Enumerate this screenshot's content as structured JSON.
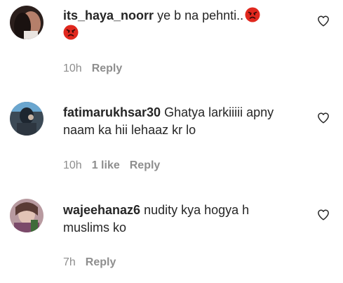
{
  "comments": [
    {
      "username": "its_haya_noorr",
      "text": "ye b na pehnti..",
      "emoji_icons": [
        "angry-face-icon",
        "angry-face-icon"
      ],
      "time": "10h",
      "likes": "",
      "reply_label": "Reply"
    },
    {
      "username": "fatimarukhsar30",
      "text": "Ghatya larkiiiii apny naam ka hii lehaaz kr lo",
      "time": "10h",
      "likes": "1 like",
      "reply_label": "Reply"
    },
    {
      "username": "wajeehanaz6",
      "text": "nudity kya hogya h muslims ko",
      "time": "7h",
      "likes": "",
      "reply_label": "Reply"
    }
  ],
  "colors": {
    "text": "#262626",
    "secondary": "#8e8e8e",
    "angry_emoji": "#e0281e"
  },
  "icons": {
    "like": "heart-outline-icon",
    "emoji": "angry-face-icon"
  }
}
